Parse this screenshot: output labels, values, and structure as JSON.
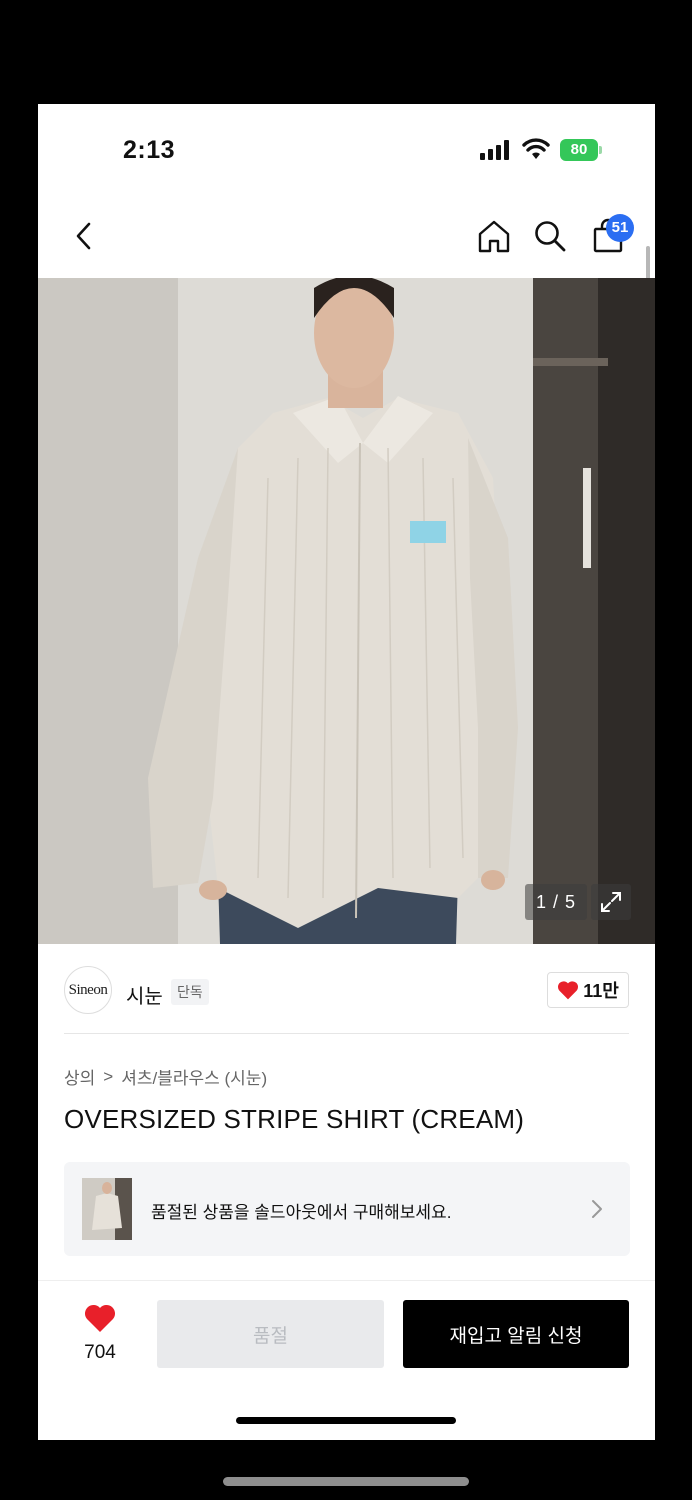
{
  "status_bar": {
    "time": "2:13",
    "battery": "80"
  },
  "nav": {
    "back_icon": "chevron-left-icon",
    "home_icon": "home-icon",
    "search_icon": "search-icon",
    "cart_icon": "shopping-bag-icon",
    "cart_count": "51"
  },
  "gallery": {
    "counter": "1 / 5",
    "expand_icon": "expand-icon"
  },
  "brand": {
    "logo_text": "Sineon",
    "name": "시눈",
    "tag": "단독",
    "like_count": "11만"
  },
  "breadcrumb": {
    "category": "상의",
    "separator": ">",
    "subcategory": "셔츠/블라우스 (시눈)"
  },
  "product": {
    "title": "OVERSIZED STRIPE SHIRT (CREAM)"
  },
  "banner": {
    "text": "품절된 상품을 솔드아웃에서 구매해보세요."
  },
  "bottom_bar": {
    "like_count": "704",
    "soldout_label": "품절",
    "restock_label": "재입고 알림 신청"
  },
  "colors": {
    "accent_blue": "#2b6ef2",
    "heart_red": "#e8202a",
    "battery_green": "#34c759",
    "primary_button": "#000000"
  }
}
